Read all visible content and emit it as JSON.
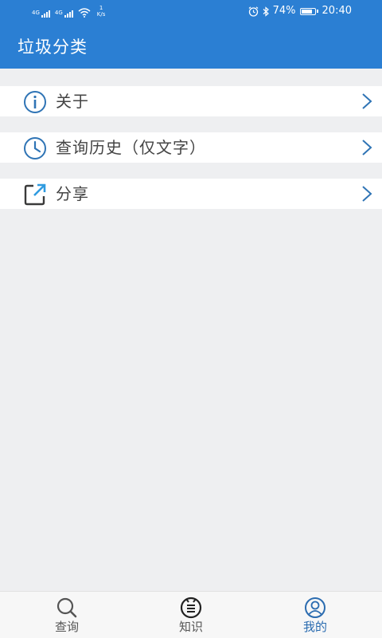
{
  "status_bar": {
    "signal1_tag": "4G",
    "signal2_tag": "4G",
    "speed_value": "1",
    "speed_unit": "K/s",
    "battery": "74%",
    "time": "20:40"
  },
  "header": {
    "title": "垃圾分类"
  },
  "menu": {
    "items": [
      {
        "label": "关于",
        "icon": "info-icon"
      },
      {
        "label": "查询历史（仅文字）",
        "icon": "clock-icon"
      },
      {
        "label": "分享",
        "icon": "share-icon"
      }
    ]
  },
  "tabbar": {
    "items": [
      {
        "label": "查询",
        "icon": "search-icon",
        "active": false
      },
      {
        "label": "知识",
        "icon": "knowledge-icon",
        "active": false
      },
      {
        "label": "我的",
        "icon": "profile-icon",
        "active": true
      }
    ]
  },
  "colors": {
    "primary": "#2b7fd3",
    "background": "#eeeff1",
    "active_tab": "#2b6cb0",
    "icon_blue": "#2f74b5",
    "icon_dark": "#3a3a3a"
  }
}
